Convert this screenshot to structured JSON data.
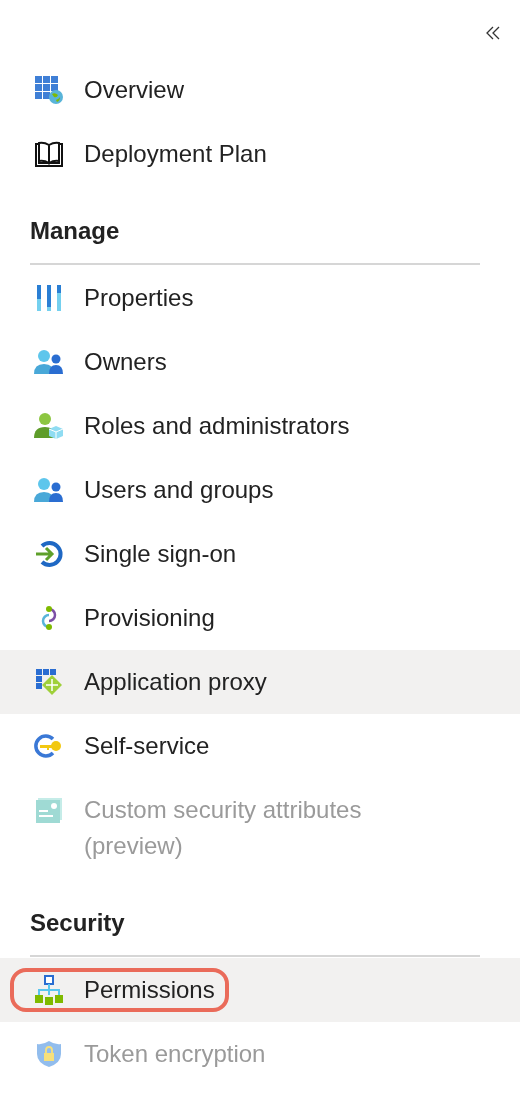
{
  "sections": [
    {
      "items": [
        {
          "label": "Overview",
          "selected": false,
          "disabled": false
        },
        {
          "label": "Deployment Plan",
          "selected": false,
          "disabled": false
        }
      ]
    },
    {
      "heading": "Manage",
      "items": [
        {
          "label": "Properties",
          "selected": false,
          "disabled": false
        },
        {
          "label": "Owners",
          "selected": false,
          "disabled": false
        },
        {
          "label": "Roles and administrators",
          "selected": false,
          "disabled": false
        },
        {
          "label": "Users and groups",
          "selected": false,
          "disabled": false
        },
        {
          "label": "Single sign-on",
          "selected": false,
          "disabled": false
        },
        {
          "label": "Provisioning",
          "selected": false,
          "disabled": false
        },
        {
          "label": "Application proxy",
          "selected": true,
          "disabled": false
        },
        {
          "label": "Self-service",
          "selected": false,
          "disabled": false
        },
        {
          "label": "Custom security attributes (preview)",
          "selected": false,
          "disabled": true
        }
      ]
    },
    {
      "heading": "Security",
      "items": [
        {
          "label": "Permissions",
          "selected": true,
          "disabled": false,
          "outlined": true
        },
        {
          "label": "Token encryption",
          "selected": false,
          "disabled": true
        }
      ]
    }
  ]
}
